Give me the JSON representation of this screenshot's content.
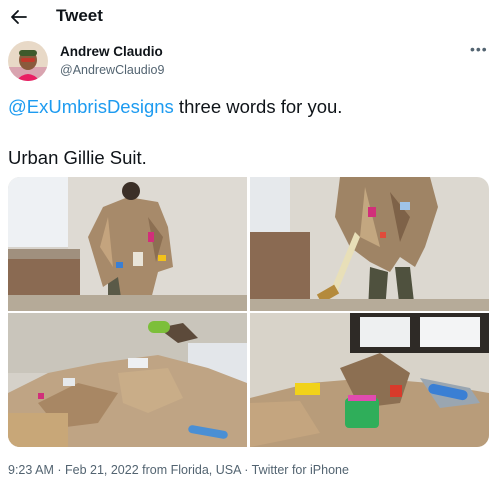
{
  "header": {
    "title": "Tweet",
    "back_icon": "arrow-left-icon"
  },
  "author": {
    "name": "Andrew Claudio",
    "handle": "@AndrewClaudio9",
    "avatar": "avatar-photo",
    "more_icon": "more-dots-icon"
  },
  "tweet": {
    "mention": "@ExUmbrisDesigns",
    "line1_rest": " three words for you.",
    "line2": "Urban Gillie Suit.",
    "mention_color": "#1d9bf0"
  },
  "media": [
    {
      "description": "person wearing cardboard gillie suit front view"
    },
    {
      "description": "person wearing cardboard gillie suit side view holding bottle"
    },
    {
      "description": "pile of cardboard gillie suit on floor"
    },
    {
      "description": "gillie suit with green basket and cans on floor"
    }
  ],
  "footer": {
    "time": "9:23 AM",
    "sep1": " · ",
    "date": "Feb 21, 2022 from Florida, USA",
    "sep2": " · ",
    "source": "Twitter for iPhone"
  }
}
